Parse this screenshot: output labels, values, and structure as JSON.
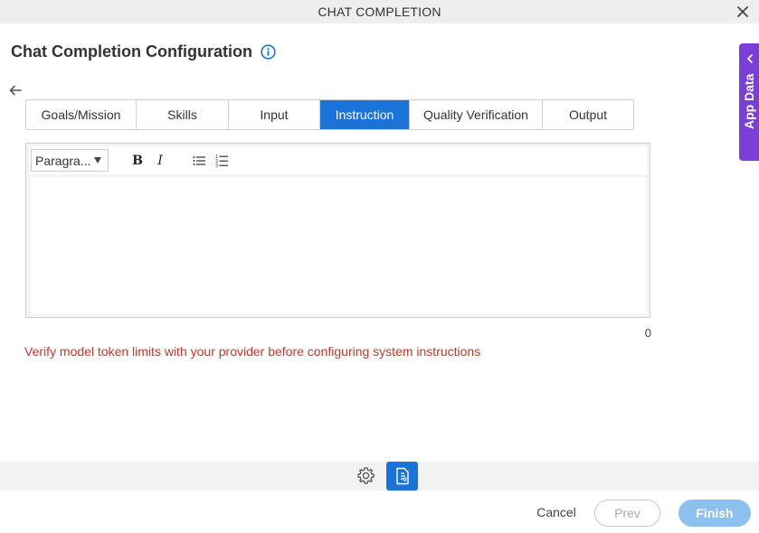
{
  "window": {
    "title": "CHAT COMPLETION",
    "close_icon": "close-icon"
  },
  "header": {
    "title": "Chat Completion Configuration",
    "info_icon": "info-icon"
  },
  "nav": {
    "back_icon": "back-arrow-icon"
  },
  "tabs": [
    {
      "label": "Goals/Mission",
      "active": false
    },
    {
      "label": "Skills",
      "active": false
    },
    {
      "label": "Input",
      "active": false
    },
    {
      "label": "Instruction",
      "active": true
    },
    {
      "label": "Quality Verification",
      "active": false
    },
    {
      "label": "Output",
      "active": false
    }
  ],
  "editor": {
    "format_select": "Paragra...",
    "bold_label": "B",
    "italic_label": "I",
    "bullet_list_icon": "bullet-list-icon",
    "numbered_list_icon": "numbered-list-icon",
    "content": "",
    "char_count": "0"
  },
  "warning": "Verify model token limits with your provider before configuring system instructions",
  "side_panel": {
    "label": "App Data",
    "icon": "chevron-left-icon"
  },
  "bottom_toolbar": {
    "settings_icon": "gear-icon",
    "document_icon": "document-icon"
  },
  "footer": {
    "cancel": "Cancel",
    "prev": "Prev",
    "finish": "Finish"
  },
  "colors": {
    "accent": "#1a73d8",
    "side_panel": "#7b3fd9",
    "warning": "#c0392b",
    "finish_disabled": "#8cc0ee"
  }
}
